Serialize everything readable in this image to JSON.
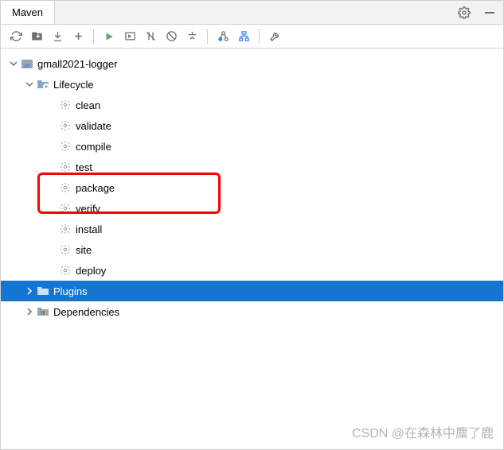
{
  "header": {
    "title": "Maven"
  },
  "tree": {
    "project": "gmall2021-logger",
    "lifecycle": {
      "label": "Lifecycle",
      "goals": [
        "clean",
        "validate",
        "compile",
        "test",
        "package",
        "verify",
        "install",
        "site",
        "deploy"
      ],
      "highlighted": "package"
    },
    "plugins": {
      "label": "Plugins",
      "selected": true
    },
    "dependencies": {
      "label": "Dependencies"
    }
  },
  "watermark": "CSDN @在森林中麋了鹿"
}
